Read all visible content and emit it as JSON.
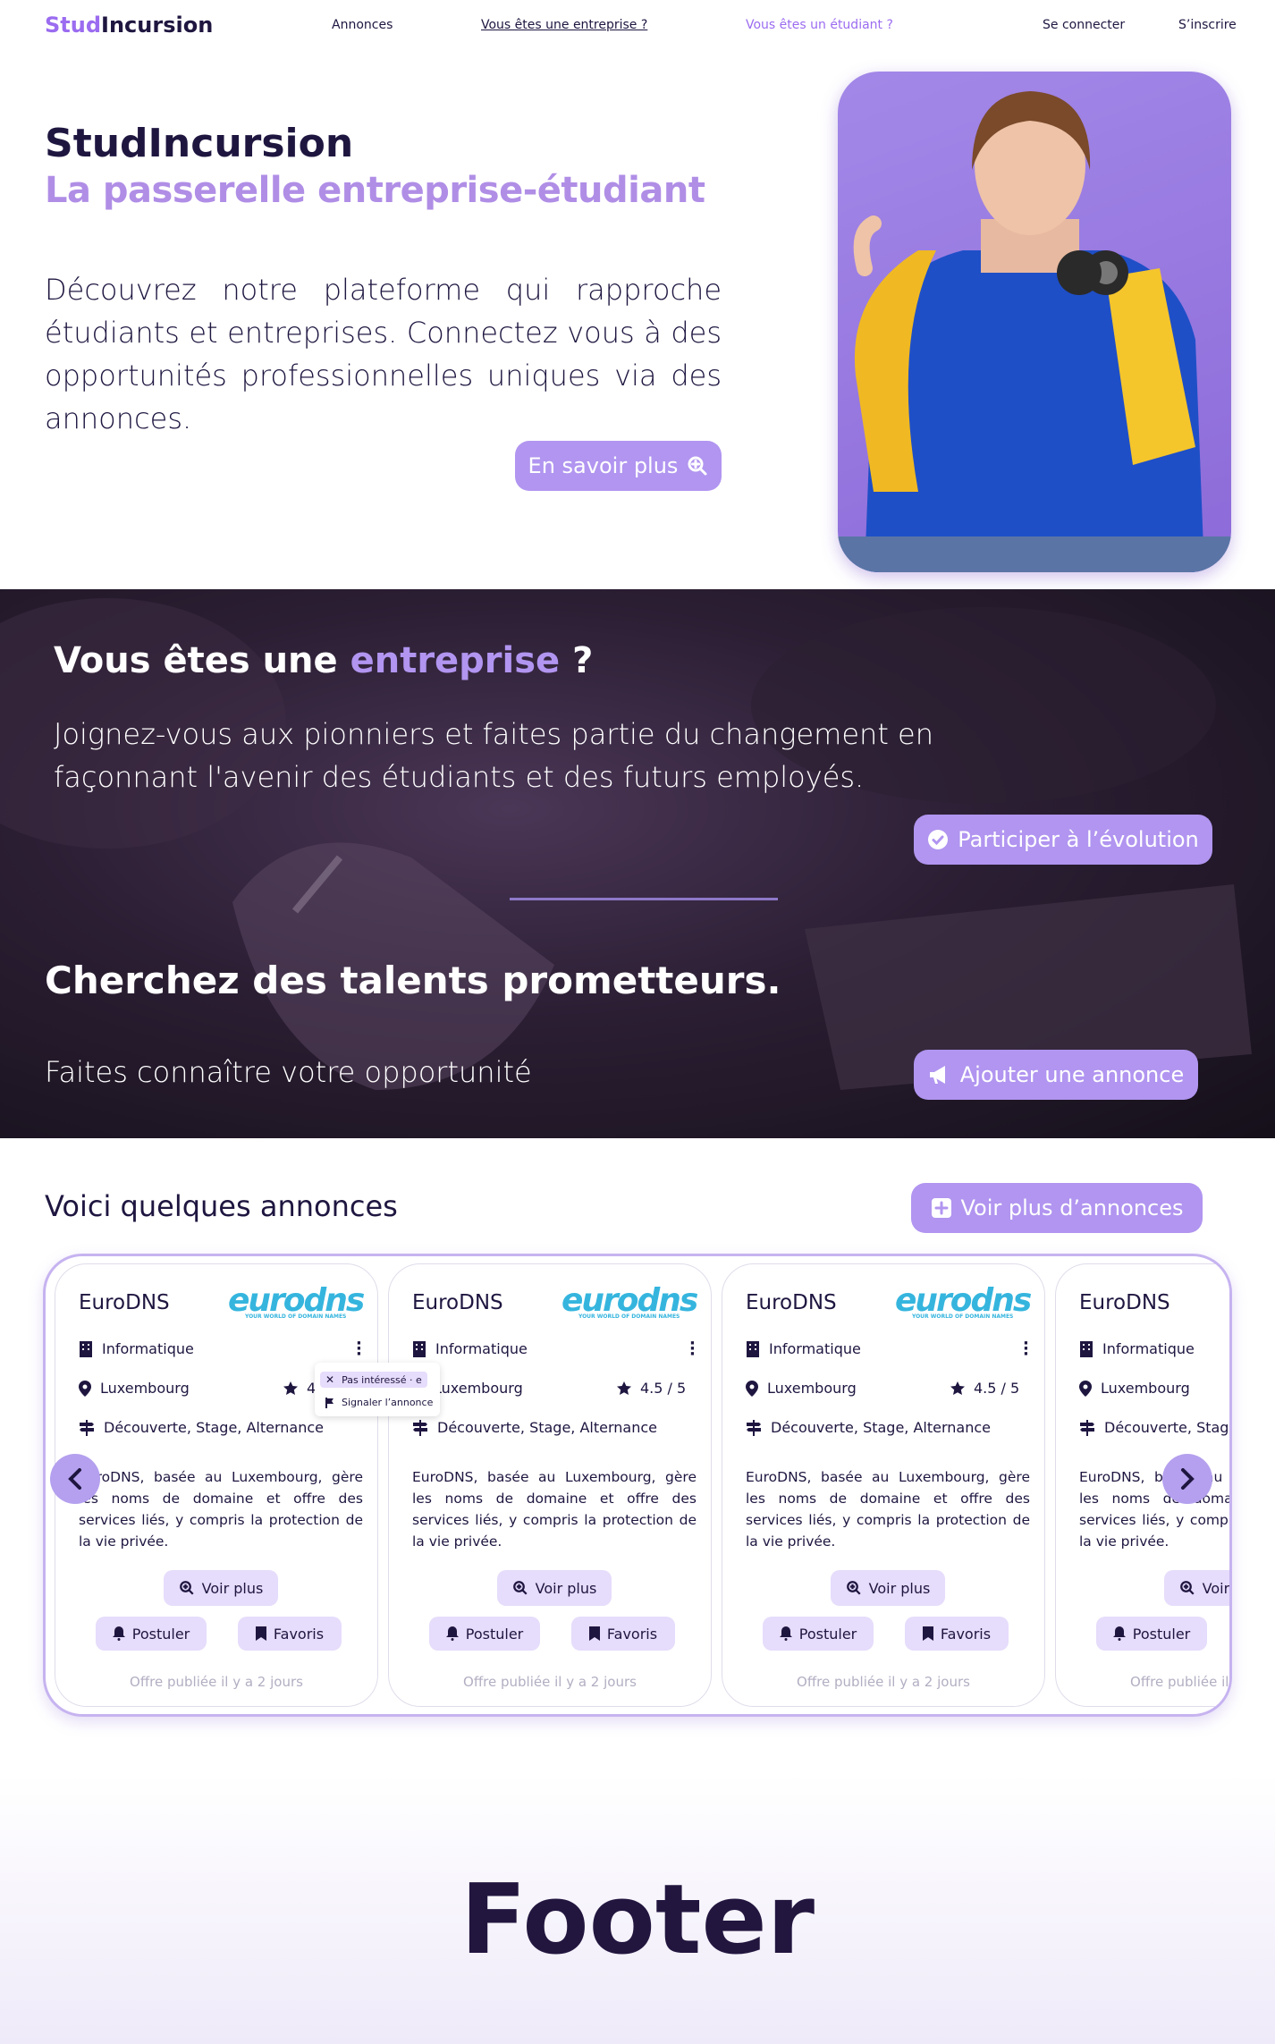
{
  "nav": {
    "logo_a": "Stud",
    "logo_b": "Incursion",
    "annonces": "Annonces",
    "entreprise": "Vous êtes une entreprise ?",
    "etudiant": "Vous êtes un étudiant ?",
    "login": "Se connecter",
    "signup": "S’inscrire"
  },
  "hero": {
    "title": "StudIncursion",
    "subtitle": "La passerelle entreprise-étudiant",
    "text": "Découvrez notre plateforme qui rapproche étudiants et entreprises. Connectez vous à des opportunités professionnelles uniques via des annonces.",
    "cta": "En savoir plus"
  },
  "company": {
    "title_a": "Vous êtes une ",
    "title_b": "entreprise",
    "title_c": " ?",
    "text": "Joignez-vous aux pionniers et faites partie du changement en façonnant l'avenir des étudiants et des futurs employés.",
    "cta": "Participer à l’évolution",
    "talents_title": "Cherchez des talents prometteurs.",
    "talents_text": "Faites connaître votre opportunité",
    "talents_cta": "Ajouter une annonce"
  },
  "listings": {
    "title": "Voici quelques annonces",
    "more": "Voir plus d’annonces",
    "cards": [
      {
        "company": "EuroDNS",
        "logo": "eurodns",
        "logo_tag": "YOUR WORLD OF DOMAIN NAMES",
        "sector": "Informatique",
        "city": "Luxembourg",
        "rating": "4.5 / 5",
        "types": "Découverte, Stage, Alternance",
        "desc": "EuroDNS, basée au Luxembourg, gère les noms de domaine et offre des services liés, y compris la protection de la vie privée.",
        "more": "Voir plus",
        "apply": "Postuler",
        "fav": "Favoris",
        "posted": "Offre publiée il y a 2 jours"
      },
      {
        "company": "EuroDNS",
        "logo": "eurodns",
        "logo_tag": "YOUR WORLD OF DOMAIN NAMES",
        "sector": "Informatique",
        "city": "Luxembourg",
        "rating": "4.5 / 5",
        "types": "Découverte, Stage, Alternance",
        "desc": "EuroDNS, basée au Luxembourg, gère les noms de domaine et offre des services liés, y compris la protection de la vie privée.",
        "more": "Voir plus",
        "apply": "Postuler",
        "fav": "Favoris",
        "posted": "Offre publiée il y a 2 jours"
      },
      {
        "company": "EuroDNS",
        "logo": "eurodns",
        "logo_tag": "YOUR WORLD OF DOMAIN NAMES",
        "sector": "Informatique",
        "city": "Luxembourg",
        "rating": "4.5 / 5",
        "types": "Découverte, Stage, Alternance",
        "desc": "EuroDNS, basée au Luxembourg, gère les noms de domaine et offre des services liés, y compris la protection de la vie privée.",
        "more": "Voir plus",
        "apply": "Postuler",
        "fav": "Favoris",
        "posted": "Offre publiée il y a 2 jours"
      },
      {
        "company": "EuroDNS",
        "sector": "Informatique",
        "city": "Luxembourg",
        "types": "Découverte, Stage, Alternance",
        "desc": "EuroDNS, basée au Luxembourg, gère les noms de domaine et offre des services liés, y compris la protection de la vie privée.",
        "more": "Voir plus",
        "apply": "Postuler",
        "posted": "Offre publiée il y a 2 jours"
      }
    ],
    "menu": {
      "not_interested": "Pas intéressé · e",
      "report": "Signaler l’annonce"
    }
  },
  "footer": {
    "label": "Footer"
  },
  "colors": {
    "accent": "#b195f0",
    "dark": "#1f1640",
    "logo_blue": "#35b5de"
  }
}
